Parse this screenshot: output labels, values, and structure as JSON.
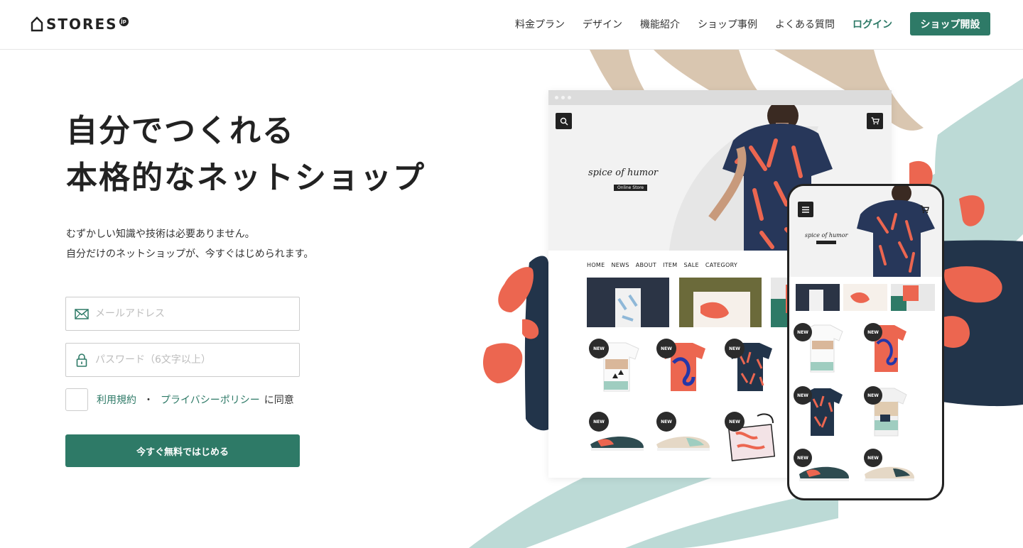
{
  "brand": {
    "logo_text": "STORES",
    "logo_badge": "jp",
    "accent": "#2e7a67"
  },
  "nav": {
    "items": [
      "料金プラン",
      "デザイン",
      "機能紹介",
      "ショップ事例",
      "よくある質問"
    ],
    "login": "ログイン",
    "open_shop": "ショップ開設"
  },
  "hero": {
    "headline": [
      "自分でつくれる",
      "本格的なネットショップ"
    ],
    "lead": [
      "むずかしい知識や技術は必要ありません。",
      "自分だけのネットショップが、今すぐはじめられます。"
    ]
  },
  "signup": {
    "email_placeholder": "メールアドレス",
    "password_placeholder": "パスワード（6文字以上）",
    "terms_link": "利用規約",
    "separator": "・",
    "privacy_link": "プライバシーポリシー",
    "agree_text": "に同意",
    "submit": "今すぐ無料ではじめる"
  },
  "mockup": {
    "shop_name": "spice of humor",
    "shop_tagline": "Online Store",
    "shop_nav": [
      "HOME",
      "NEWS",
      "ABOUT",
      "ITEM",
      "SALE",
      "CATEGORY"
    ],
    "badge": "NEW",
    "icons": [
      "search-icon",
      "cart-icon",
      "menu-icon"
    ]
  },
  "colors": {
    "green": "#2e7a67",
    "coral": "#ec6650",
    "navy": "#22344a",
    "mint": "#bcdad6",
    "beige": "#d9c6b0"
  }
}
